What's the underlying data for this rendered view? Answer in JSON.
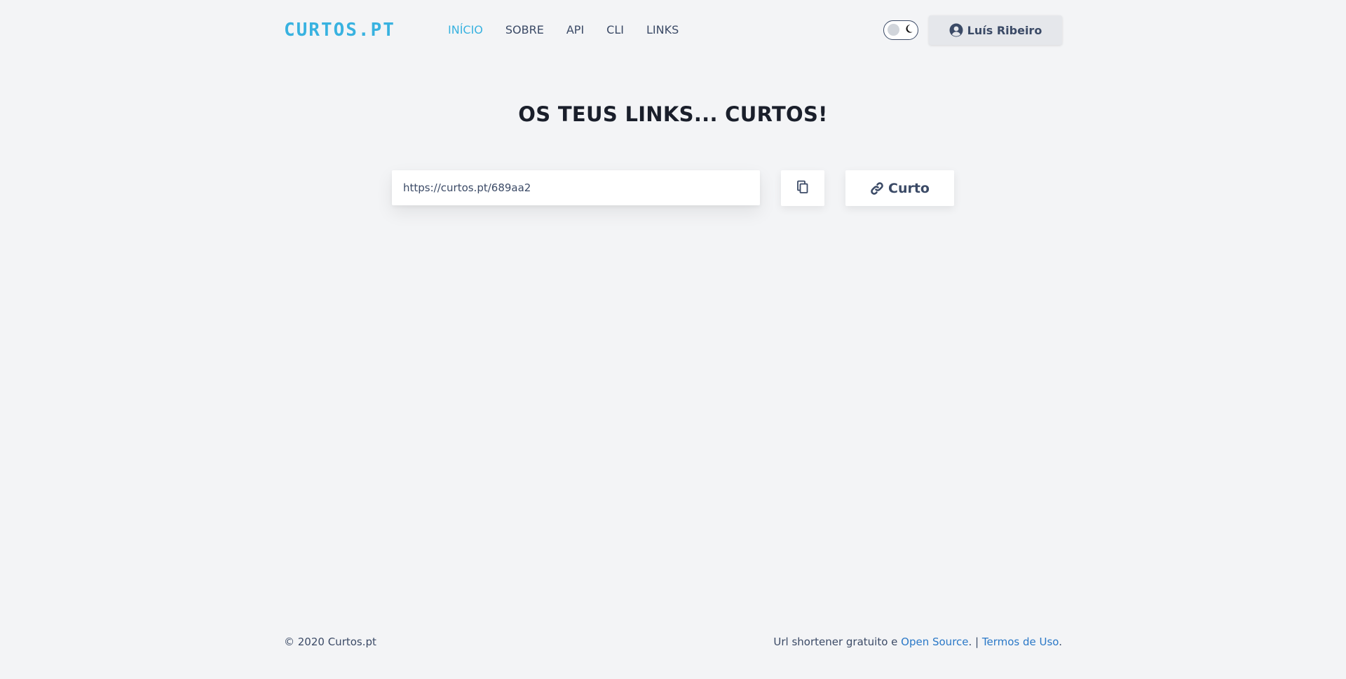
{
  "brand": {
    "logo_text": "CURTOS.PT",
    "accent_color": "#38b2e0"
  },
  "nav": {
    "items": [
      {
        "label": "INÍCIO",
        "active": true
      },
      {
        "label": "SOBRE",
        "active": false
      },
      {
        "label": "API",
        "active": false
      },
      {
        "label": "CLI",
        "active": false
      },
      {
        "label": "LINKS",
        "active": false
      }
    ]
  },
  "header": {
    "theme_toggle": {
      "icon": "moon-icon",
      "state": "light"
    },
    "user": {
      "name": "Luís Ribeiro",
      "icon": "user-circle-icon"
    }
  },
  "main": {
    "title": "OS TEUS LINKS... CURTOS!",
    "url_value": "https://curtos.pt/689aa2",
    "copy_icon": "copy-icon",
    "shorten_label": "Curto",
    "shorten_icon": "link-icon"
  },
  "footer": {
    "copyright": "© 2020 Curtos.pt",
    "tagline_prefix": "Url shortener gratuito e ",
    "open_source_label": "Open Source",
    "separator": ". | ",
    "terms_label": "Termos de Uso",
    "terms_suffix": ".",
    "link_color": "#2a78c7"
  }
}
